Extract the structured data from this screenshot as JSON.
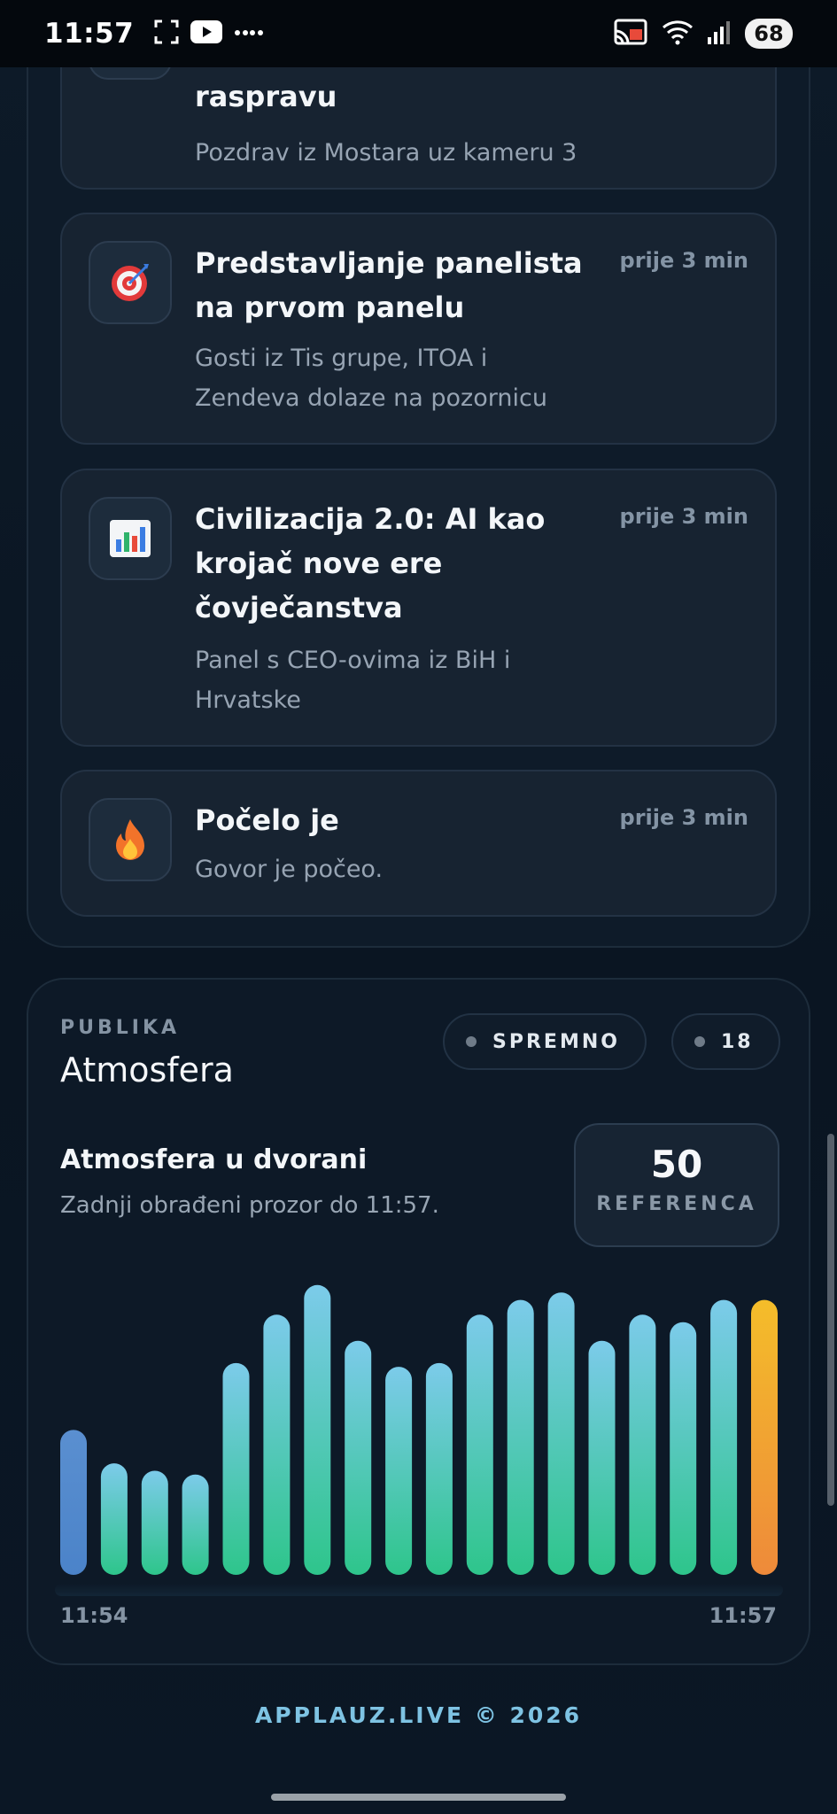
{
  "status_bar": {
    "time": "11:57",
    "battery": "68"
  },
  "feed": [
    {
      "icon": "speech-bubble-icon",
      "title": "raspravu",
      "time": "",
      "subtitle_lines": [
        "Pozdrav iz Mostara uz kameru 3"
      ]
    },
    {
      "icon": "target-icon",
      "title": "Predstavljanje panelista na prvom panelu",
      "time": "prije 3 min",
      "subtitle_lines": [
        "Gosti iz Tis grupe, ITOA i",
        "Zendeva dolaze na pozornicu"
      ]
    },
    {
      "icon": "bar-chart-icon",
      "title": "Civilizacija 2.0: AI kao krojač nove ere čovječanstva",
      "time": "prije 3 min",
      "subtitle_lines": [
        "Panel s CEO-ovima iz BiH i",
        "Hrvatske"
      ]
    },
    {
      "icon": "fire-icon",
      "title": "Počelo je",
      "time": "prije 3 min",
      "subtitle_lines": [
        "Govor je počeo."
      ]
    }
  ],
  "atmosphere": {
    "eyebrow": "PUBLIKA",
    "title": "Atmosfera",
    "status_pill": "SPREMNO",
    "count_pill": "18",
    "heading": "Atmosfera u dvorani",
    "description": "Zadnji obrađeni prozor do 11:57.",
    "reference_value": "50",
    "reference_label": "REFERENCA",
    "colors": {
      "first_bar_top": "#5a8fd0",
      "bar_top": "#7ccbea",
      "bar_bottom": "#2ec58b",
      "last_bar_top": "#f4bd2a",
      "last_bar_bottom": "#ee8a3a"
    }
  },
  "chart_data": {
    "type": "bar",
    "x_start_label": "11:54",
    "x_end_label": "11:57",
    "values": [
      39,
      30,
      28,
      27,
      57,
      70,
      78,
      63,
      56,
      57,
      70,
      74,
      76,
      63,
      70,
      68,
      74,
      74
    ],
    "ylim": [
      0,
      82
    ],
    "grid": false,
    "legend": "none"
  },
  "footer": "APPLAUZ.LIVE © 2026"
}
